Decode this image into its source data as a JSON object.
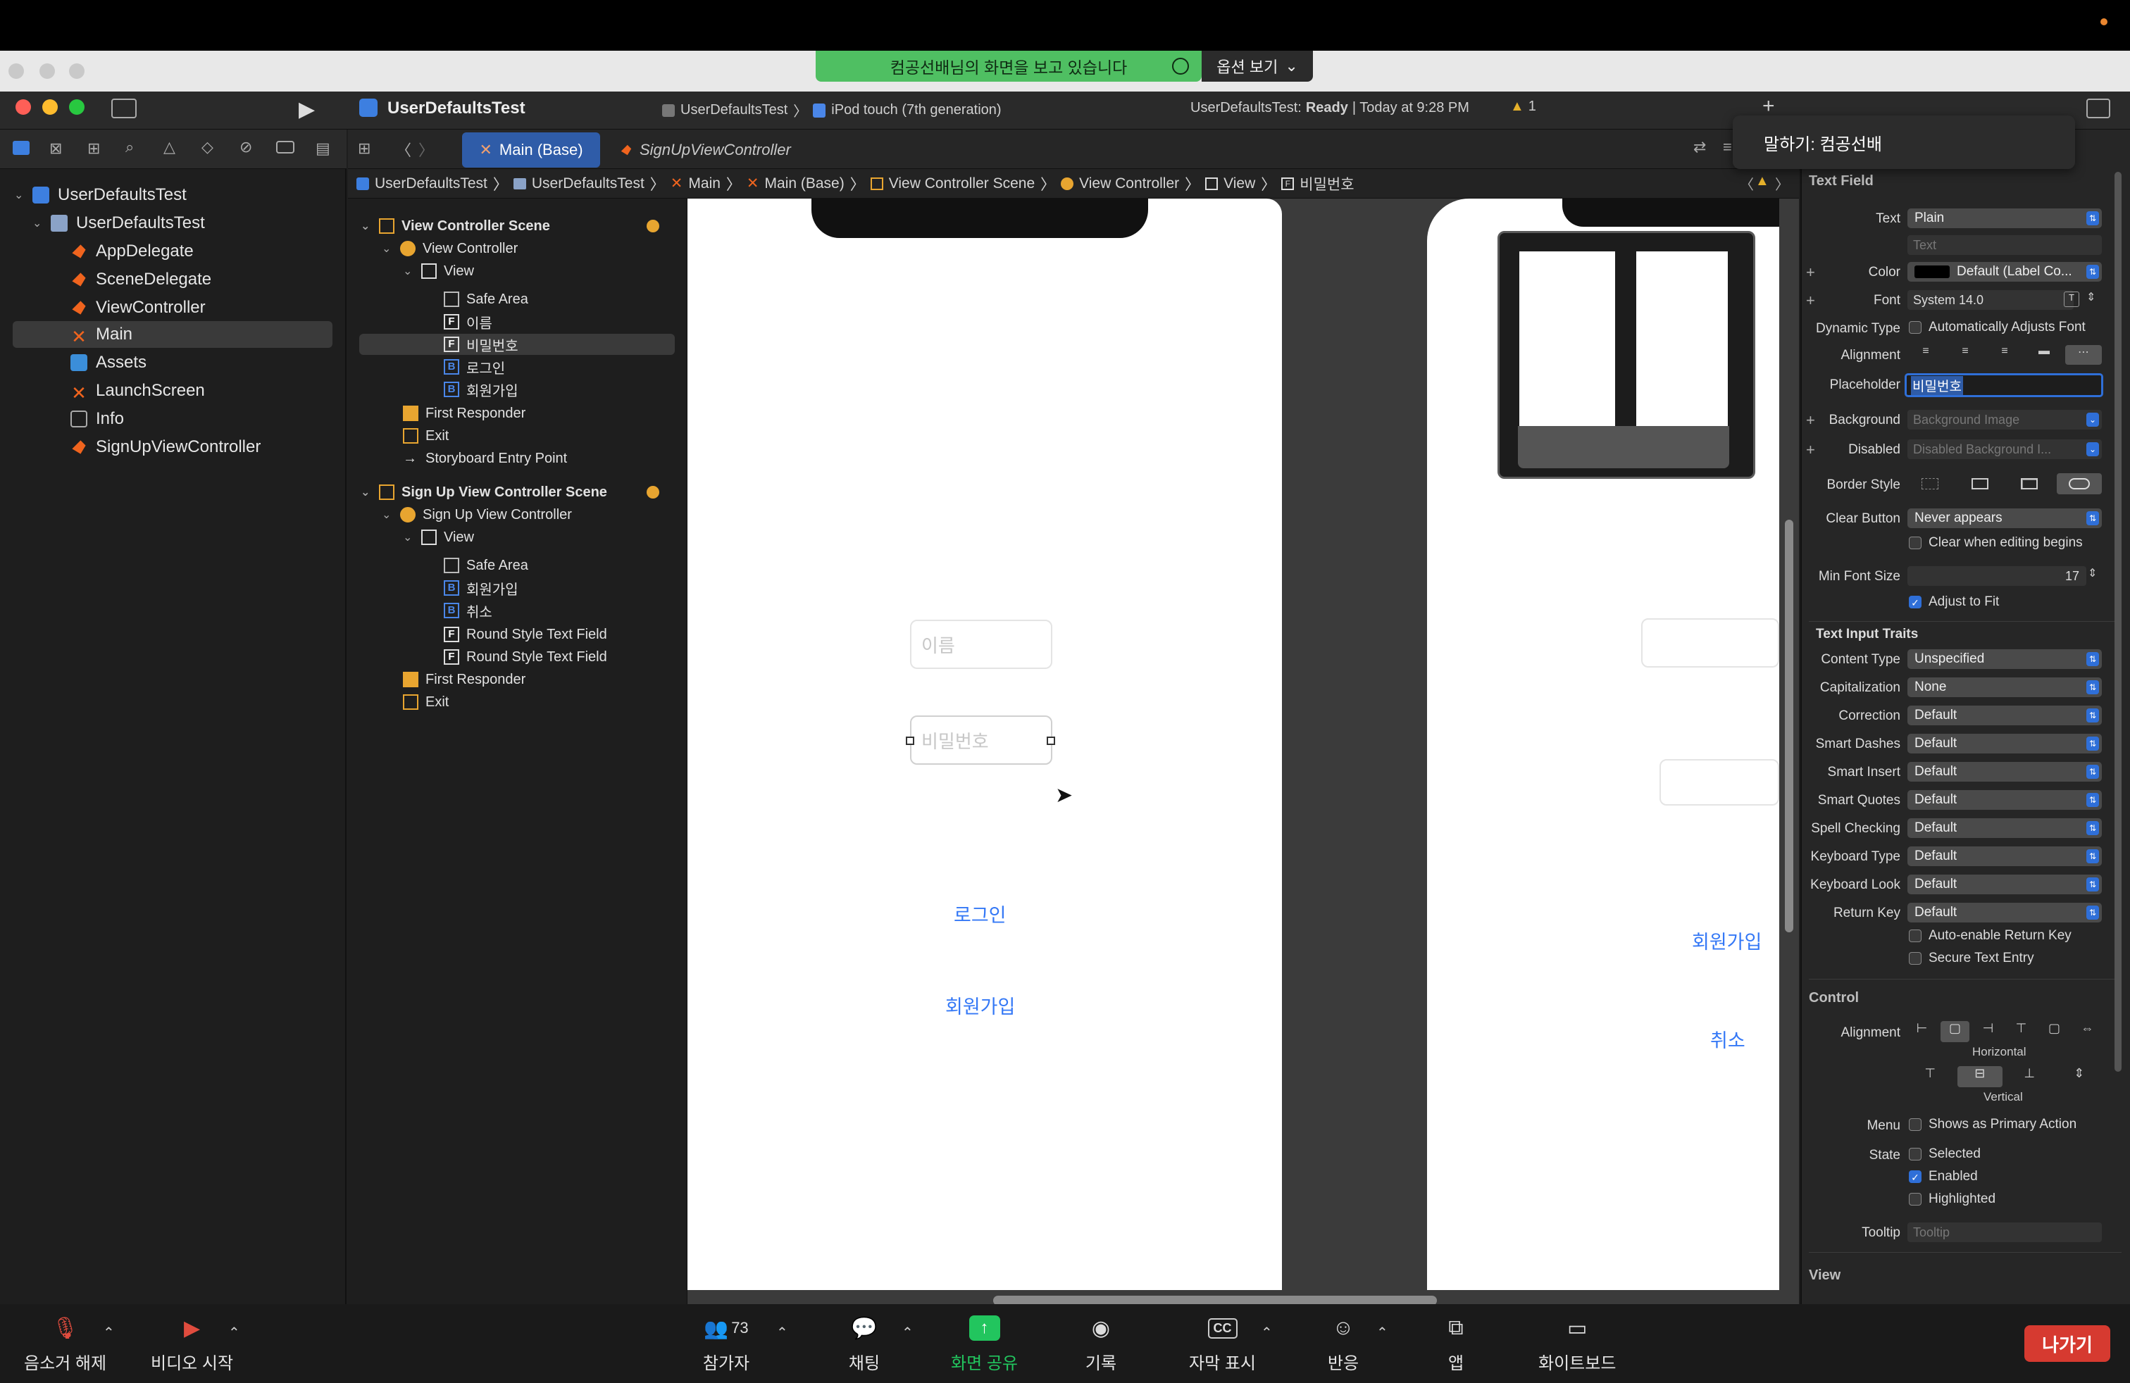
{
  "zoom_header": {
    "share_text": "컴공선배님의 화면을 보고 있습니다",
    "view_options": "옵션 보기"
  },
  "xcode": {
    "project_title": "UserDefaultsTest",
    "scheme": "UserDefaultsTest",
    "destination": "iPod touch (7th generation)",
    "status_project": "UserDefaultsTest:",
    "status_state": "Ready",
    "status_time": "| Today at 9:28 PM",
    "warning_count": "1"
  },
  "navigator": {
    "items": [
      {
        "label": "UserDefaultsTest",
        "icon": "project-icon"
      },
      {
        "label": "UserDefaultsTest",
        "icon": "folder-icon"
      },
      {
        "label": "AppDelegate",
        "icon": "swift-file-icon"
      },
      {
        "label": "SceneDelegate",
        "icon": "swift-file-icon"
      },
      {
        "label": "ViewController",
        "icon": "swift-file-icon"
      },
      {
        "label": "Main",
        "icon": "storyboard-icon"
      },
      {
        "label": "Assets",
        "icon": "assets-icon"
      },
      {
        "label": "LaunchScreen",
        "icon": "storyboard-icon"
      },
      {
        "label": "Info",
        "icon": "plist-icon"
      },
      {
        "label": "SignUpViewController",
        "icon": "swift-file-icon"
      }
    ]
  },
  "tabs": {
    "main": "Main (Base)",
    "signup": "SignUpViewController"
  },
  "jumpbar": [
    "UserDefaultsTest",
    "UserDefaultsTest",
    "Main",
    "Main (Base)",
    "View Controller Scene",
    "View Controller",
    "View",
    "비밀번호"
  ],
  "outline": {
    "rows": [
      "View Controller Scene",
      "View Controller",
      "View",
      "Safe Area",
      "이름",
      "비밀번호",
      "로그인",
      "회원가입",
      "First Responder",
      "Exit",
      "Storyboard Entry Point",
      "Sign Up View Controller Scene",
      "Sign Up View Controller",
      "View",
      "Safe Area",
      "회원가입",
      "취소",
      "Round Style Text Field",
      "Round Style Text Field",
      "First Responder",
      "Exit"
    ]
  },
  "canvas": {
    "name_placeholder": "이름",
    "password_placeholder": "비밀번호",
    "login_button": "로그인",
    "signup_button": "회원가입",
    "signup_screen_join": "회원가입",
    "signup_screen_cancel": "취소"
  },
  "speaker": "말하기: 컴공선배",
  "inspector": {
    "section_textfield": "Text Field",
    "text_label": "Text",
    "text_value": "Plain",
    "text_placeholder": "Text",
    "color_label": "Color",
    "color_value": "Default (Label Co...",
    "font_label": "Font",
    "font_value": "System 14.0",
    "dynamic_type_label": "Dynamic Type",
    "dynamic_type_value": "Automatically Adjusts Font",
    "alignment_label": "Alignment",
    "placeholder_label": "Placeholder",
    "placeholder_value": "비밀번호",
    "background_label": "Background",
    "background_value": "Background Image",
    "disabled_label": "Disabled",
    "disabled_value": "Disabled Background I...",
    "border_style_label": "Border Style",
    "clear_button_label": "Clear Button",
    "clear_button_value": "Never appears",
    "clear_editing": "Clear when editing begins",
    "min_font_label": "Min Font Size",
    "min_font_value": "17",
    "adjust_fit": "Adjust to Fit",
    "traits_head": "Text Input Traits",
    "content_type_label": "Content Type",
    "content_type_value": "Unspecified",
    "capitalization_label": "Capitalization",
    "capitalization_value": "None",
    "correction_label": "Correction",
    "correction_value": "Default",
    "smart_dashes_label": "Smart Dashes",
    "smart_dashes_value": "Default",
    "smart_insert_label": "Smart Insert",
    "smart_insert_value": "Default",
    "smart_quotes_label": "Smart Quotes",
    "smart_quotes_value": "Default",
    "spell_label": "Spell Checking",
    "spell_value": "Default",
    "keyboard_type_label": "Keyboard Type",
    "keyboard_type_value": "Default",
    "keyboard_look_label": "Keyboard Look",
    "keyboard_look_value": "Default",
    "return_key_label": "Return Key",
    "return_key_value": "Default",
    "auto_return": "Auto-enable Return Key",
    "secure_entry": "Secure Text Entry",
    "control_head": "Control",
    "ctrl_alignment_label": "Alignment",
    "horizontal": "Horizontal",
    "vertical": "Vertical",
    "menu_label": "Menu",
    "menu_value": "Shows as Primary Action",
    "state_label": "State",
    "state_selected": "Selected",
    "state_enabled": "Enabled",
    "state_highlighted": "Highlighted",
    "tooltip_label": "Tooltip",
    "tooltip_placeholder": "Tooltip",
    "view_head": "View"
  },
  "zoom_bar": {
    "unmute": "음소거 해제",
    "start_video": "비디오 시작",
    "participants": "참가자",
    "participant_count": "73",
    "chat": "채팅",
    "share_screen": "화면 공유",
    "record": "기록",
    "captions": "자막 표시",
    "captions_icon_text": "CC",
    "reactions": "반응",
    "apps": "앱",
    "whiteboard": "화이트보드",
    "leave": "나가기"
  },
  "colors": {
    "share_green": "#4fbf62",
    "xcode_accent": "#2f6fd8",
    "link_blue": "#3478f6",
    "leave_red": "#d63a30"
  }
}
